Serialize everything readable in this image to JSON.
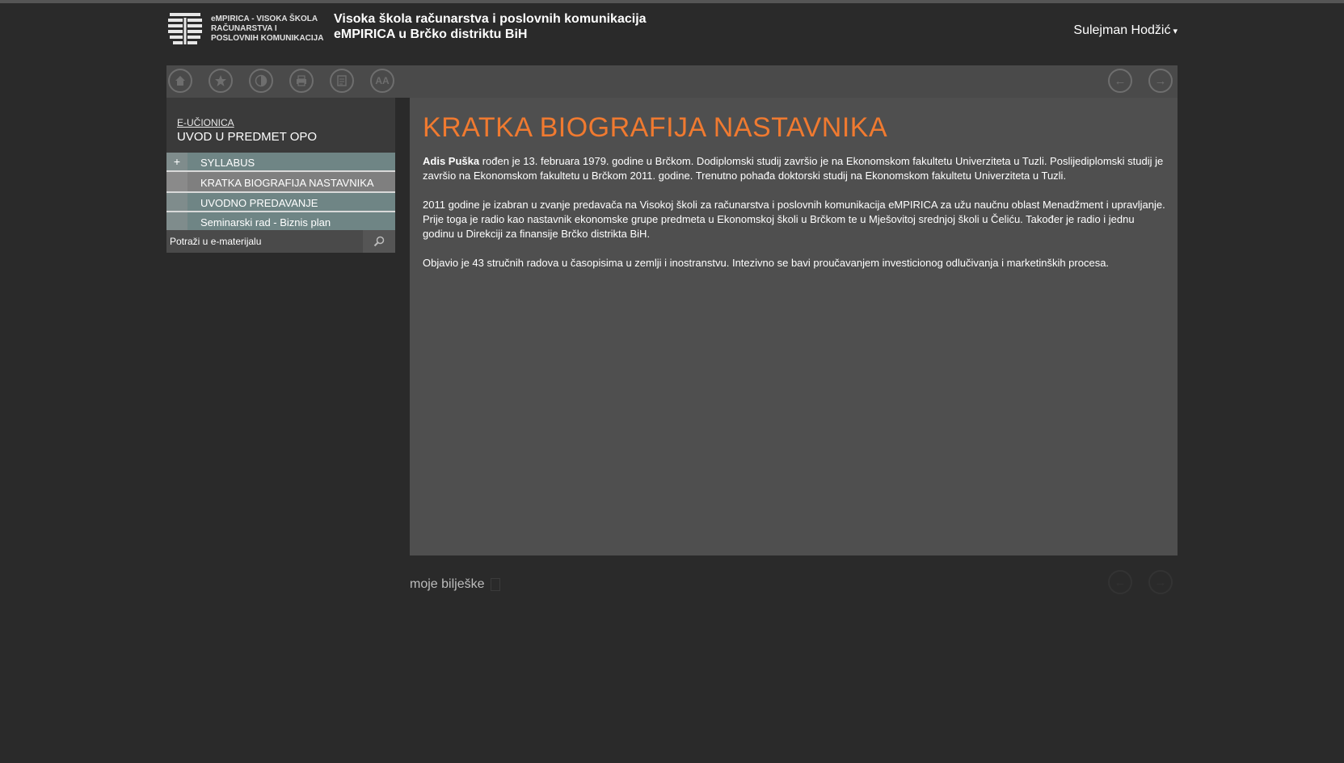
{
  "header": {
    "logo_text": "eMPIRICA - VISOKA ŠKOLA RAČUNARSTVA I POSLOVNIH KOMUNIKACIJA",
    "title_line1": "Visoka škola računarstva i poslovnih komunikacija",
    "title_line2": "eMPIRICA u Brčko distriktu BiH",
    "user_name": "Sulejman Hodžić",
    "user_caret": "▾"
  },
  "toolbar": {
    "icons": [
      "home-icon",
      "star-icon",
      "contrast-icon",
      "print-icon",
      "document-icon",
      "font-size-icon"
    ],
    "font_size_glyph": "AA",
    "prev_glyph": "←",
    "next_glyph": "→"
  },
  "sidebar": {
    "breadcrumb": "E-UČIONICA",
    "course": "UVOD U PREDMET OPO",
    "items": [
      {
        "handle": "+",
        "label": "SYLLABUS"
      },
      {
        "handle": "",
        "label": "KRATKA BIOGRAFIJA NASTAVNIKA"
      },
      {
        "handle": "",
        "label": "UVODNO PREDAVANJE"
      },
      {
        "handle": "",
        "label": "Seminarski rad - Biznis plan"
      }
    ],
    "search_placeholder": "Potraži u e-materijalu"
  },
  "content": {
    "title": "KRATKA BIOGRAFIJA NASTAVNIKA",
    "author": "Adis Puška",
    "p1_rest": " rođen je 13. februara 1979. godine u Brčkom. Dodiplomski studij završio je na Ekonomskom fakultetu Univerziteta u Tuzli. Poslijediplomski studij je završio na Ekonomskom fakultetu u Brčkom 2011. godine. Trenutno pohađa doktorski studij na Ekonomskom fakultetu Univerziteta u Tuzli.",
    "p2": "2011 godine je izabran u zvanje predavača na Visokoj školi za računarstva i poslovnih komunikacija eMPIRICA za užu naučnu oblast Menadžment i upravljanje. Prije toga je radio kao nastavnik ekonomske grupe predmeta u Ekonomskoj školi u Brčkom te u Mješovitoj srednjoj školi u Čeliću. Također je radio i jednu godinu u Direkciji za finansije Brčko distrikta BiH.",
    "p3": "Objavio je 43 stručnih radova u časopisima u zemlji i inostranstvu. Intezivno se bavi proučavanjem investicionog odlučivanja i marketinških procesa."
  },
  "footer": {
    "notes_label": "moje bilješke"
  },
  "colors": {
    "background": "#2a2a2a",
    "accent_title": "#f07a30",
    "panel": "#4f4f4f",
    "sidebar_teal": "#6f8585"
  }
}
